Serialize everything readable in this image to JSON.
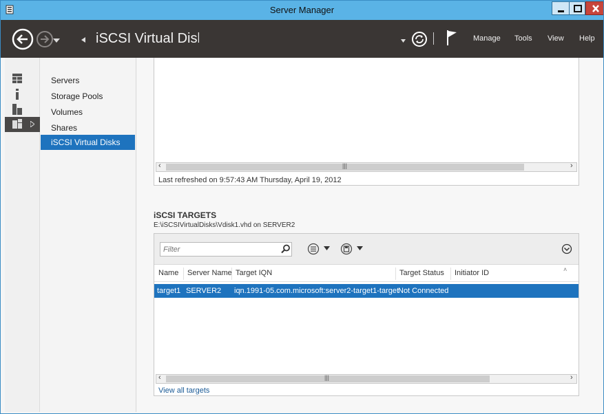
{
  "window": {
    "title": "Server Manager",
    "colors": {
      "titlebar": "#5ab3e6",
      "header": "#3a3634",
      "selection": "#1e73be",
      "close": "#c7453b"
    }
  },
  "header": {
    "page_title": "iSCSI Virtual Disks",
    "menus": {
      "manage": "Manage",
      "tools": "Tools",
      "view": "View",
      "help": "Help"
    }
  },
  "leftbar": {
    "icons": [
      "dashboard-icon",
      "local-server-icon",
      "all-servers-icon",
      "file-storage-icon"
    ]
  },
  "nav": {
    "items": [
      "Servers",
      "Storage Pools",
      "Volumes",
      "Shares",
      "iSCSI Virtual Disks"
    ],
    "selected": "iSCSI Virtual Disks"
  },
  "upper_panel": {
    "last_refreshed": "Last refreshed on 9:57:43 AM Thursday, April 19, 2012"
  },
  "targets": {
    "title": "iSCSI TARGETS",
    "subtitle": "E:\\iSCSIVirtualDisks\\Vdisk1.vhd on SERVER2",
    "filter_placeholder": "Filter",
    "columns": [
      "Name",
      "Server Name",
      "Target IQN",
      "Target Status",
      "Initiator ID"
    ],
    "rows": [
      {
        "name": "target1",
        "server": "SERVER2",
        "iqn": "iqn.1991-05.com.microsoft:server2-target1-target",
        "status": "Not Connected",
        "initiator": ""
      }
    ],
    "view_all": "View all targets"
  }
}
